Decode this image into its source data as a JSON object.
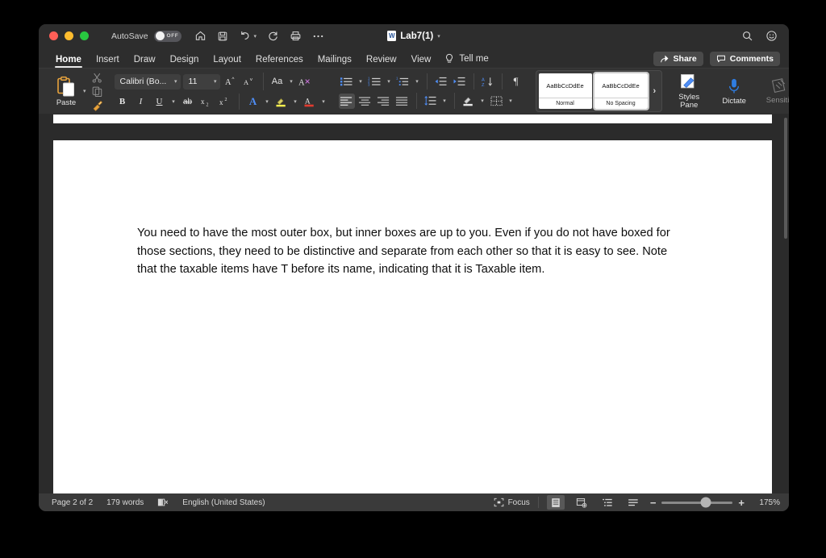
{
  "window": {
    "traffic_lights": [
      "close",
      "minimize",
      "zoom"
    ],
    "autosave": {
      "label": "AutoSave",
      "state": "OFF"
    },
    "title": "Lab7(1)",
    "quick_access": [
      "home-icon",
      "save-icon",
      "undo-icon",
      "redo-icon",
      "print-icon",
      "more-icon"
    ],
    "title_right_icons": [
      "search-icon",
      "smiley-icon"
    ]
  },
  "tabs": [
    {
      "label": "Home",
      "active": true
    },
    {
      "label": "Insert",
      "active": false
    },
    {
      "label": "Draw",
      "active": false
    },
    {
      "label": "Design",
      "active": false
    },
    {
      "label": "Layout",
      "active": false
    },
    {
      "label": "References",
      "active": false
    },
    {
      "label": "Mailings",
      "active": false
    },
    {
      "label": "Review",
      "active": false
    },
    {
      "label": "View",
      "active": false
    }
  ],
  "tell_me": {
    "label": "Tell me",
    "icon": "lightbulb-icon"
  },
  "share_button": {
    "label": "Share",
    "icon": "share-icon"
  },
  "comments_button": {
    "label": "Comments",
    "icon": "comment-icon"
  },
  "ribbon": {
    "paste": {
      "label": "Paste",
      "icon": "clipboard-icon"
    },
    "cut": {
      "icon": "scissors-icon"
    },
    "copy": {
      "icon": "copy-icon"
    },
    "format_painter": {
      "icon": "format-painter-icon"
    },
    "font_name": "Calibri (Bo...",
    "font_size": "11",
    "grow_font": {
      "icon": "grow-font-icon"
    },
    "shrink_font": {
      "icon": "shrink-font-icon"
    },
    "change_case": {
      "icon": "change-case-icon",
      "label": "Aa"
    },
    "clear_formatting": {
      "icon": "clear-formatting-icon"
    },
    "bold": {
      "label": "B"
    },
    "italic": {
      "label": "I"
    },
    "underline": {
      "label": "U"
    },
    "strikethrough": {
      "label": "ab"
    },
    "subscript": {
      "label": "x2"
    },
    "superscript": {
      "label": "x2"
    },
    "text_effects": {
      "icon": "text-effects-icon",
      "label": "A"
    },
    "highlight": {
      "icon": "highlight-icon",
      "color": "#ffeb3b"
    },
    "font_color": {
      "icon": "font-color-icon",
      "color": "#e03b2f"
    },
    "bullets": {
      "icon": "bullets-icon"
    },
    "numbering": {
      "icon": "numbering-icon"
    },
    "multilevel": {
      "icon": "multilevel-list-icon"
    },
    "decrease_indent": {
      "icon": "decrease-indent-icon"
    },
    "increase_indent": {
      "icon": "increase-indent-icon"
    },
    "sort": {
      "icon": "sort-icon"
    },
    "show_marks": {
      "icon": "pilcrow-icon",
      "label": "¶"
    },
    "align_left": {
      "icon": "align-left-icon",
      "active": true
    },
    "align_center": {
      "icon": "align-center-icon"
    },
    "align_right": {
      "icon": "align-right-icon"
    },
    "justify": {
      "icon": "justify-icon"
    },
    "line_spacing": {
      "icon": "line-spacing-icon"
    },
    "shading": {
      "icon": "shading-icon"
    },
    "borders": {
      "icon": "borders-icon"
    },
    "styles": [
      {
        "preview": "AaBbCcDdEe",
        "name": "Normal",
        "selected": false
      },
      {
        "preview": "AaBbCcDdEe",
        "name": "No Spacing",
        "selected": true
      }
    ],
    "styles_more": "›",
    "styles_pane": {
      "label_line1": "Styles",
      "label_line2": "Pane",
      "icon": "styles-pane-icon"
    },
    "dictate": {
      "label": "Dictate",
      "icon": "microphone-icon"
    },
    "sensitivity": {
      "label": "Sensitivity",
      "icon": "sensitivity-icon",
      "disabled": true
    }
  },
  "document": {
    "body_text": "You need to have the most outer box, but inner boxes are up to you. Even if you do not have boxed for those sections, they need to be distinctive and separate from each other so that it is easy to see. Note that the taxable items have T before its name, indicating that it is Taxable item."
  },
  "status_bar": {
    "page": "Page 2 of 2",
    "words": "179 words",
    "proofing_icon": "proofing-errors-icon",
    "language": "English (United States)",
    "focus": {
      "label": "Focus",
      "icon": "focus-icon"
    },
    "view_print": {
      "icon": "print-layout-icon",
      "active": true
    },
    "view_web": {
      "icon": "web-layout-icon"
    },
    "view_outline": {
      "icon": "outline-view-icon"
    },
    "view_draft": {
      "icon": "draft-view-icon"
    },
    "zoom_out": "−",
    "zoom_in": "+",
    "zoom_level": "175%",
    "zoom_slider_percent": 62
  }
}
